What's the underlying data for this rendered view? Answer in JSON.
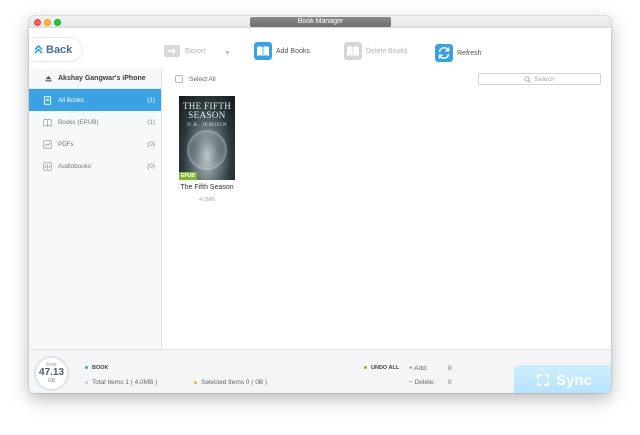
{
  "window": {
    "title": "Book Manager"
  },
  "toolbar": {
    "back_label": "Back",
    "export_label": "Export",
    "add_books_label": "Add Books",
    "delete_books_label": "Delete Books",
    "refresh_label": "Refresh"
  },
  "sidebar": {
    "device_name": "Akshay Gangwar's iPhone",
    "items": [
      {
        "label": "All Books",
        "count": "(1)",
        "icon": "book-icon",
        "active": true
      },
      {
        "label": "Books (EPUB)",
        "count": "(1)",
        "icon": "open-book-icon",
        "active": false
      },
      {
        "label": "PDFs",
        "count": "(0)",
        "icon": "pdf-icon",
        "active": false
      },
      {
        "label": "Audiobooks",
        "count": "(0)",
        "icon": "audiobook-icon",
        "active": false
      }
    ]
  },
  "content": {
    "select_all_label": "Select All",
    "search_placeholder": "Search",
    "books": [
      {
        "title": "The Fifth Season",
        "size": "4.0MB",
        "format_badge": "EPUB",
        "cover_title": "THE FIFTH SEASON",
        "cover_author": "N.K. JEMISIN"
      }
    ]
  },
  "status": {
    "storage_free_label": "Free",
    "storage_value": "47.13",
    "storage_unit": "GB",
    "category_label": "BOOK",
    "total_items": "Total Items 1 ( 4.0MB )",
    "selected_items": "Selected Items 0 ( 0B )",
    "undo_all_label": "UNDO ALL",
    "add_label": "+ Add:",
    "add_value": "0",
    "delete_label": "− Delete:",
    "delete_value": "0",
    "sync_label": "Sync"
  },
  "colors": {
    "accent": "#3aa1e3",
    "add_dot": "#7fb82e",
    "selected_dot": "#f0b429",
    "total_dot": "#c8c8c8",
    "book_dot": "#3aa1e3"
  }
}
